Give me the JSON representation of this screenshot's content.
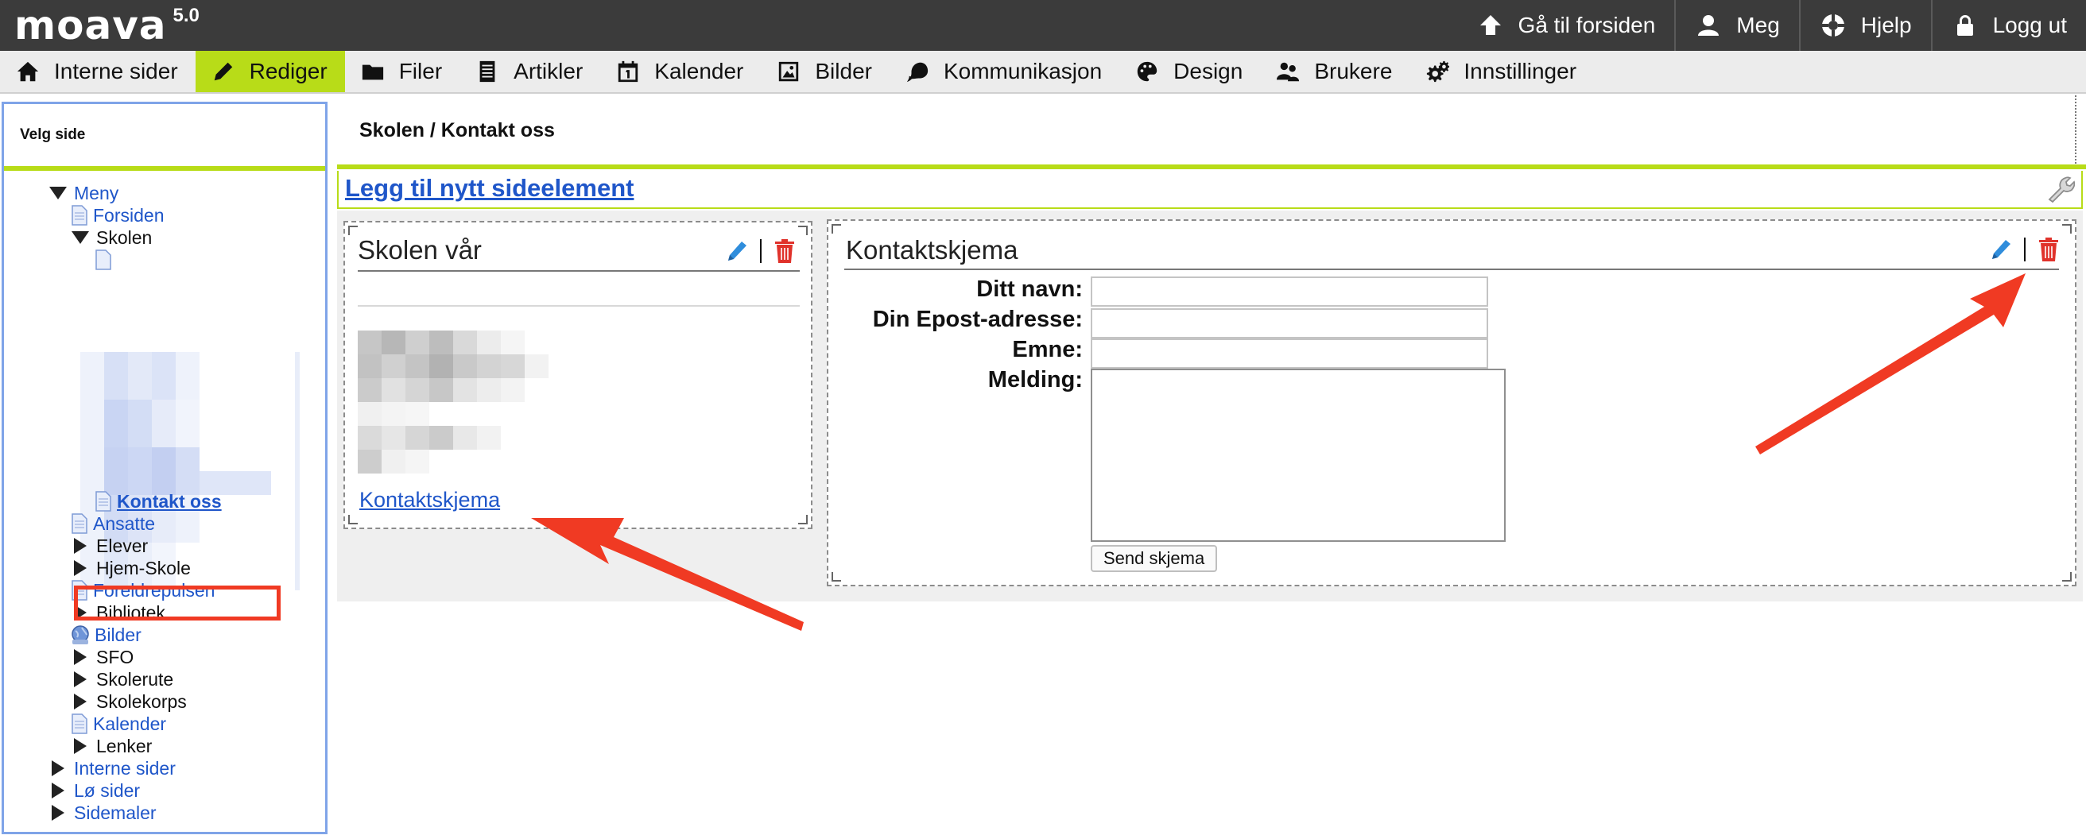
{
  "app": {
    "brand": "moava",
    "version": "5.0"
  },
  "toplinks": [
    {
      "label": "Gå til forsiden",
      "icon": "home-up-icon"
    },
    {
      "label": "Meg",
      "icon": "user-icon"
    },
    {
      "label": "Hjelp",
      "icon": "lifebuoy-icon"
    },
    {
      "label": "Logg ut",
      "icon": "lock-icon"
    }
  ],
  "mainnav": [
    {
      "label": "Interne sider",
      "icon": "home-icon"
    },
    {
      "label": "Rediger",
      "icon": "pencil-icon",
      "active": true
    },
    {
      "label": "Filer",
      "icon": "folder-icon"
    },
    {
      "label": "Artikler",
      "icon": "document-icon"
    },
    {
      "label": "Kalender",
      "icon": "calendar-icon"
    },
    {
      "label": "Bilder",
      "icon": "image-icon"
    },
    {
      "label": "Kommunikasjon",
      "icon": "chat-icon"
    },
    {
      "label": "Design",
      "icon": "palette-icon"
    },
    {
      "label": "Brukere",
      "icon": "users-icon"
    },
    {
      "label": "Innstillinger",
      "icon": "gears-icon"
    }
  ],
  "sidebar": {
    "title": "Velg side",
    "tree": {
      "meny": "Meny",
      "forsiden": "Forsiden",
      "skolen": "Skolen",
      "kontakt_oss": "Kontakt oss",
      "ansatte": "Ansatte",
      "elever": "Elever",
      "hjem_skole": "Hjem-Skole",
      "foreldrepulsen": "Foreldrepulsen",
      "bibliotek": "Bibliotek",
      "bilder": "Bilder",
      "sfo": "SFO",
      "skolerute": "Skolerute",
      "skolekorps": "Skolekorps",
      "kalender": "Kalender",
      "lenker": "Lenker",
      "interne_sider": "Interne sider",
      "lo_sider": "Lø sider",
      "sidemaler": "Sidemaler"
    }
  },
  "content": {
    "breadcrumb": "Skolen / Kontakt oss",
    "add_element": "Legg til nytt sideelement",
    "panel1": {
      "title": "Skolen vår",
      "link": "Kontaktskjema"
    },
    "panel2": {
      "title": "Kontaktskjema",
      "fields": {
        "name_label": "Ditt navn:",
        "email_label": "Din Epost-adresse:",
        "subject_label": "Emne:",
        "message_label": "Melding:"
      },
      "submit": "Send skjema"
    }
  },
  "colors": {
    "accent": "#b8dc18",
    "link": "#1f56c9",
    "annotation": "#f03a23",
    "delete": "#e0322b",
    "edit": "#2f8ddc"
  }
}
